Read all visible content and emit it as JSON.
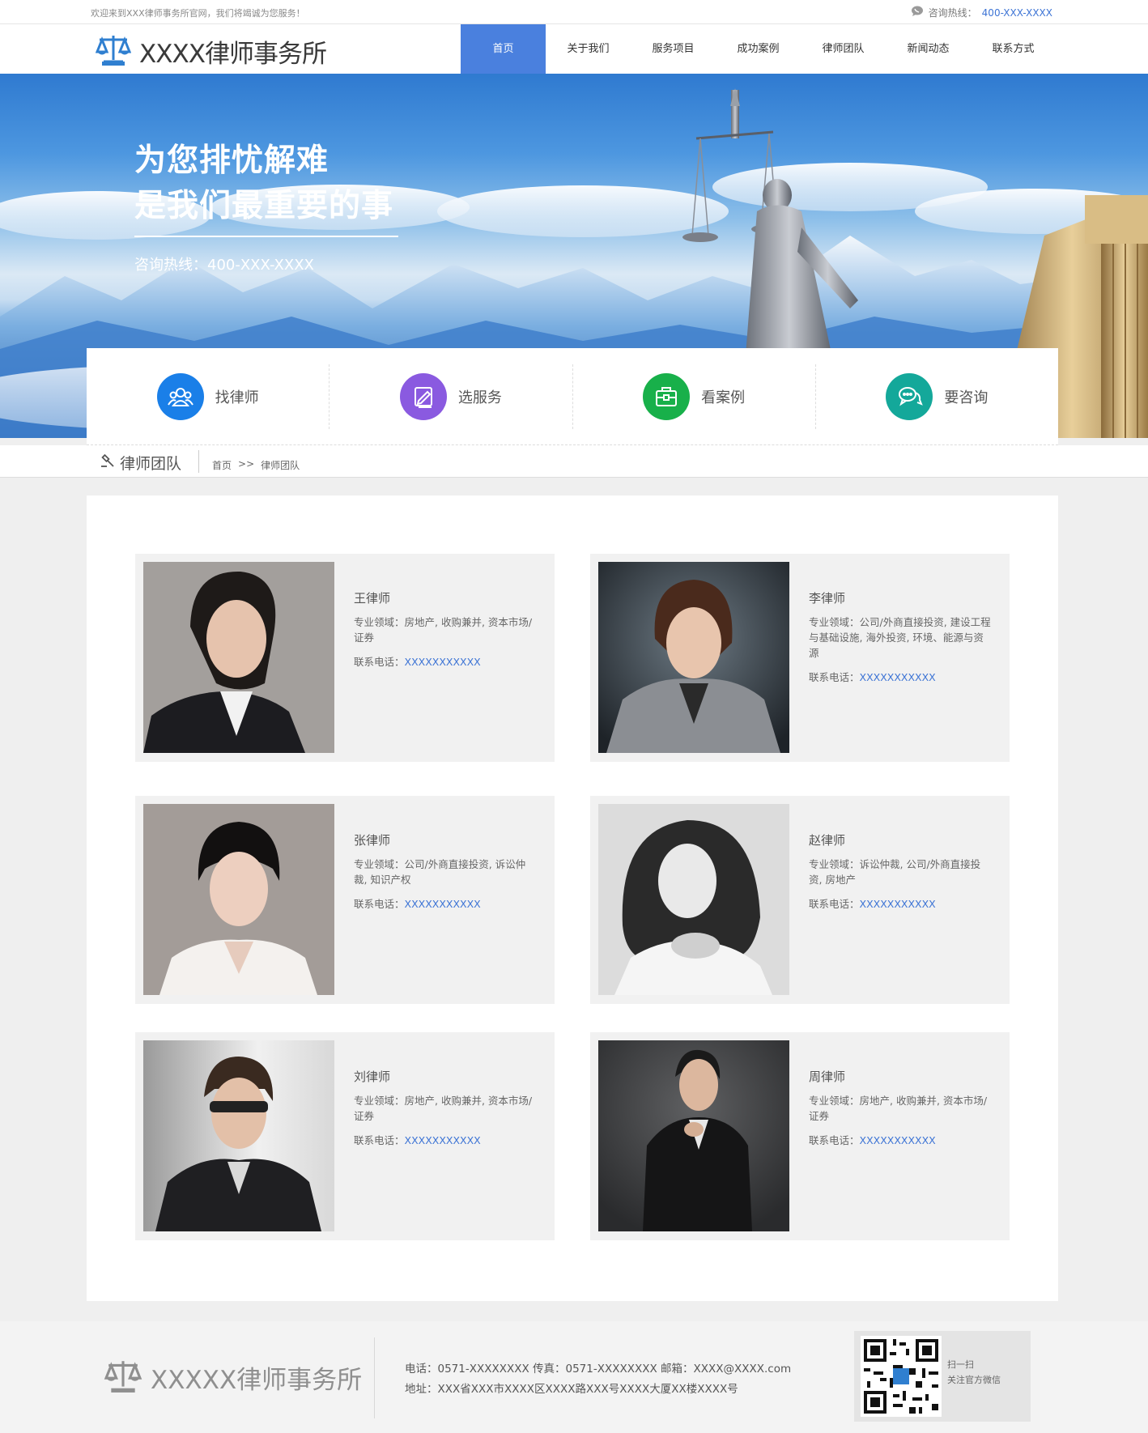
{
  "topbar": {
    "welcome": "欢迎来到XXX律师事务所官网，我们将竭诚为您服务！",
    "hotline_label": "咨询热线：",
    "hotline_number": "400-XXX-XXXX"
  },
  "header": {
    "logo_text": "XXXX律师事务所",
    "nav": [
      {
        "label": "首页",
        "active": true
      },
      {
        "label": "关于我们"
      },
      {
        "label": "服务项目"
      },
      {
        "label": "成功案例"
      },
      {
        "label": "律师团队"
      },
      {
        "label": "新闻动态"
      },
      {
        "label": "联系方式"
      }
    ]
  },
  "banner": {
    "slogan_line1": "为您排忧解难",
    "slogan_line2": "是我们最重要的事",
    "hotline": "咨询热线：400-XXX-XXXX"
  },
  "quick_links": [
    {
      "label": "找律师",
      "icon": "users-icon",
      "color": "#1a7fe8"
    },
    {
      "label": "选服务",
      "icon": "edit-document-icon",
      "color": "#8a5ae0"
    },
    {
      "label": "看案例",
      "icon": "briefcase-icon",
      "color": "#18b04a"
    },
    {
      "label": "要咨询",
      "icon": "chat-icon",
      "color": "#14a89a"
    }
  ],
  "breadcrumb": {
    "title": "律师团队",
    "home": "首页",
    "separator": ">>",
    "current": "律师团队"
  },
  "lawyers": [
    {
      "name": "王律师",
      "field": "专业领域：房地产, 收购兼并, 资本市场/证券",
      "phone_label": "联系电话：",
      "phone": "XXXXXXXXXXX"
    },
    {
      "name": "李律师",
      "field": "专业领域：公司/外商直接投资, 建设工程与基础设施, 海外投资, 环境、能源与资源",
      "phone_label": "联系电话：",
      "phone": "XXXXXXXXXXX"
    },
    {
      "name": "张律师",
      "field": "专业领域：公司/外商直接投资, 诉讼仲裁, 知识产权",
      "phone_label": "联系电话：",
      "phone": "XXXXXXXXXXX"
    },
    {
      "name": "赵律师",
      "field": "专业领域：诉讼仲裁, 公司/外商直接投资, 房地产",
      "phone_label": "联系电话：",
      "phone": "XXXXXXXXXXX"
    },
    {
      "name": "刘律师",
      "field": "专业领域：房地产, 收购兼并, 资本市场/证券",
      "phone_label": "联系电话：",
      "phone": "XXXXXXXXXXX"
    },
    {
      "name": "周律师",
      "field": "专业领域：房地产, 收购兼并, 资本市场/证券",
      "phone_label": "联系电话：",
      "phone": "XXXXXXXXXXX"
    }
  ],
  "footer": {
    "logo_text": "XXXXX律师事务所",
    "contact_line": "电话：0571-XXXXXXXX  传真：0571-XXXXXXXX  邮箱：XXXX@XXXX.com",
    "address_line": "地址：XXX省XXX市XXXX区XXXX路XXX号XXXX大厦XX楼XXXX号",
    "qr_line1": "扫一扫",
    "qr_line2": "关注官方微信"
  },
  "colors": {
    "accent": "#4a80de",
    "link": "#3d74d5"
  }
}
